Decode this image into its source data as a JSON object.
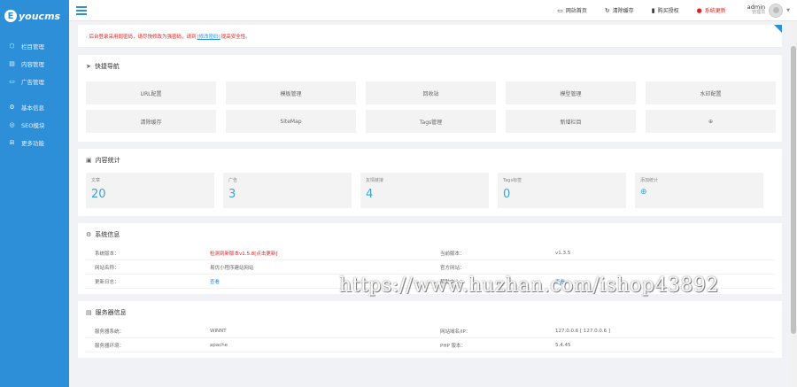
{
  "brand": {
    "mark": "E",
    "name": "youcms"
  },
  "sidebar": {
    "items": [
      {
        "icon": "cube-icon",
        "glyph": "⬡",
        "label": "栏目管理"
      },
      {
        "icon": "file-icon",
        "glyph": "▤",
        "label": "内容管理"
      },
      {
        "icon": "folder-icon",
        "glyph": "▭",
        "label": "广告管理"
      },
      {
        "icon": "gear-icon",
        "glyph": "⚙",
        "label": "基本信息"
      },
      {
        "icon": "seo-icon",
        "glyph": "◎",
        "label": "SEO模块"
      },
      {
        "icon": "grid-icon",
        "glyph": "⊞",
        "label": "更多功能"
      }
    ]
  },
  "topbar": {
    "home": "网站首页",
    "clear_cache": "清除缓存",
    "license": "购买授权",
    "update": "系统更新",
    "admin_name": "admin",
    "admin_role": "管理员"
  },
  "notice": {
    "prefix": "· 后台登录采用弱密码，请尽快修改为强密码，请到",
    "link": "[修改密码]",
    "suffix": "提高安全性。"
  },
  "quick": {
    "title": "快捷导航",
    "items": [
      "URL配置",
      "模板管理",
      "回收站",
      "模型管理",
      "水印配置",
      "清除缓存",
      "SiteMap",
      "Tags管理",
      "新增栏目",
      "⊕"
    ]
  },
  "stats": {
    "title": "内容统计",
    "items": [
      {
        "label": "文章",
        "value": "20"
      },
      {
        "label": "广告",
        "value": "3"
      },
      {
        "label": "友情链接",
        "value": "4"
      },
      {
        "label": "Tags标签",
        "value": "0"
      },
      {
        "label": "添加统计",
        "value": "⊕"
      }
    ]
  },
  "system": {
    "title": "系统信息",
    "rows": [
      {
        "k1": "系统版本：",
        "v1": "检测到新版本v1.5.8[点击更新]",
        "k2": "当前版本：",
        "v2": "v1.3.5"
      },
      {
        "k1": "网站名称：",
        "v1": "易优小程序建站网站",
        "k2": "官方网站：",
        "v2": ""
      },
      {
        "k1": "更新日志：",
        "v1": "查看",
        "k2": "帮助中心：",
        "v2": "查看"
      }
    ]
  },
  "server": {
    "title": "服务器信息",
    "rows": [
      {
        "k1": "服务器系统：",
        "v1": "WINNT",
        "k2": "网站域名/IP：",
        "v2": "127.0.0.6 [ 127.0.0.6 ]"
      },
      {
        "k1": "服务器环境：",
        "v1": "apache",
        "k2": "PHP 版本：",
        "v2": "5.4.45"
      }
    ]
  },
  "watermark": "https://www.huzhan.com/ishop43892"
}
